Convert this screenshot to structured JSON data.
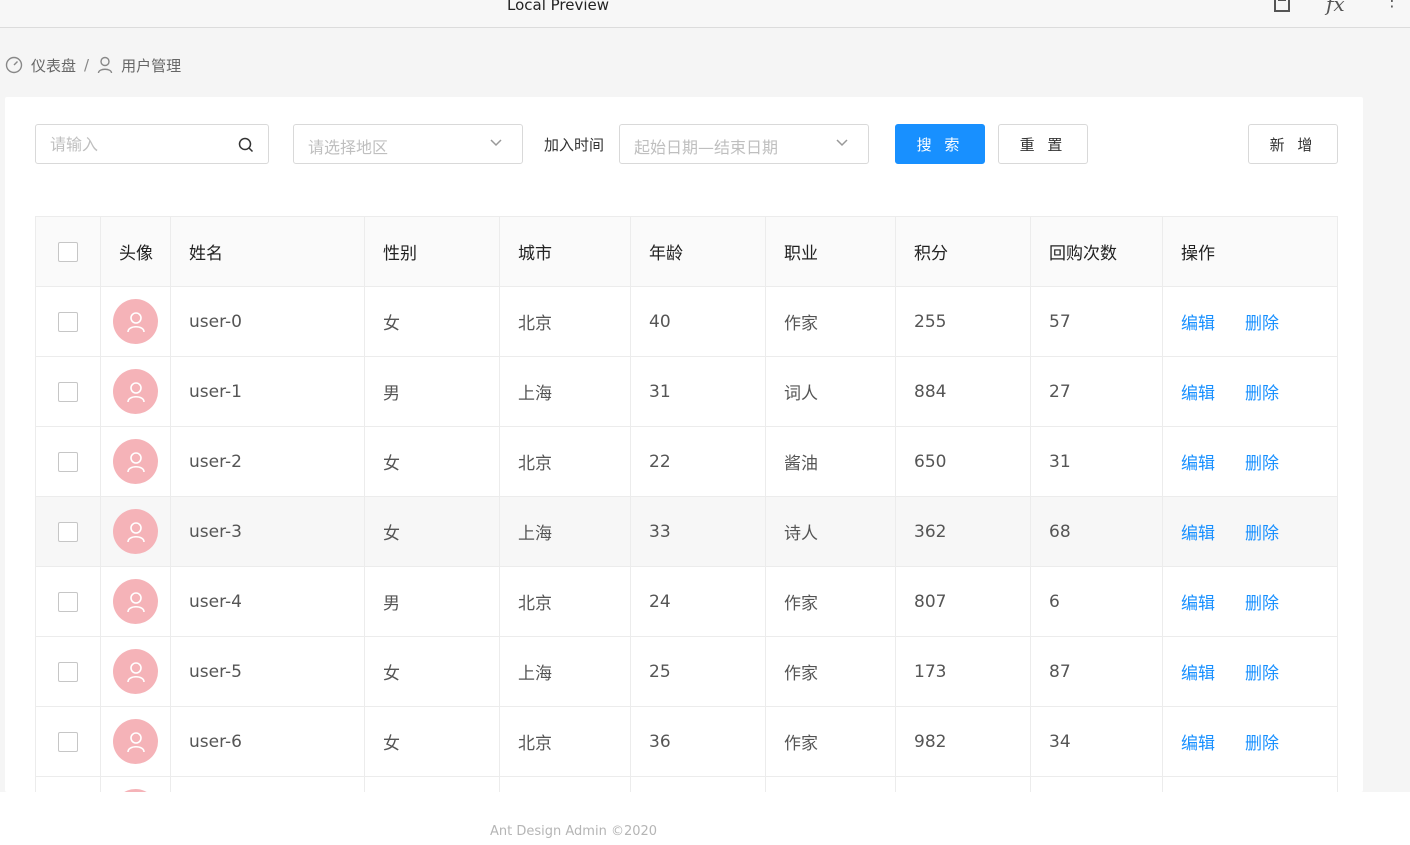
{
  "window": {
    "title": "Local Preview"
  },
  "toolbar_icons": [
    "document-icon",
    "formula-icon",
    "more-vertical-icon"
  ],
  "breadcrumb": {
    "home": "仪表盘",
    "separator": "/",
    "current": "用户管理"
  },
  "filters": {
    "search_placeholder": "请输入",
    "region_placeholder": "请选择地区",
    "join_time_label": "加入时间",
    "date_placeholder": "起始日期—结束日期",
    "search_button": "搜 索",
    "reset_button": "重 置",
    "add_button": "新 增"
  },
  "table": {
    "columns": [
      "头像",
      "姓名",
      "性别",
      "城市",
      "年龄",
      "职业",
      "积分",
      "回购次数",
      "操作"
    ],
    "rows": [
      {
        "name": "user-0",
        "gender": "女",
        "city": "北京",
        "age": "40",
        "job": "作家",
        "score": "255",
        "repurchase": "57",
        "edit": "编辑",
        "delete": "删除"
      },
      {
        "name": "user-1",
        "gender": "男",
        "city": "上海",
        "age": "31",
        "job": "词人",
        "score": "884",
        "repurchase": "27",
        "edit": "编辑",
        "delete": "删除"
      },
      {
        "name": "user-2",
        "gender": "女",
        "city": "北京",
        "age": "22",
        "job": "酱油",
        "score": "650",
        "repurchase": "31",
        "edit": "编辑",
        "delete": "删除"
      },
      {
        "name": "user-3",
        "gender": "女",
        "city": "上海",
        "age": "33",
        "job": "诗人",
        "score": "362",
        "repurchase": "68",
        "edit": "编辑",
        "delete": "删除"
      },
      {
        "name": "user-4",
        "gender": "男",
        "city": "北京",
        "age": "24",
        "job": "作家",
        "score": "807",
        "repurchase": "6",
        "edit": "编辑",
        "delete": "删除"
      },
      {
        "name": "user-5",
        "gender": "女",
        "city": "上海",
        "age": "25",
        "job": "作家",
        "score": "173",
        "repurchase": "87",
        "edit": "编辑",
        "delete": "删除"
      },
      {
        "name": "user-6",
        "gender": "女",
        "city": "北京",
        "age": "36",
        "job": "作家",
        "score": "982",
        "repurchase": "34",
        "edit": "编辑",
        "delete": "删除"
      }
    ]
  },
  "footer": {
    "text": "Ant Design Admin ©2020"
  },
  "colors": {
    "primary": "#1890ff",
    "avatar_bg": "#f5b3b8",
    "row_highlight": "#f7f7f7"
  }
}
